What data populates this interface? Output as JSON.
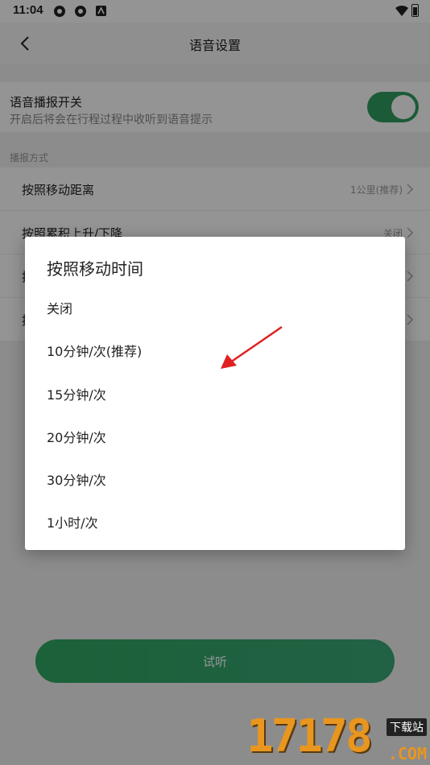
{
  "status": {
    "time": "11:04"
  },
  "appbar": {
    "title": "语音设置"
  },
  "voice_switch": {
    "label": "语音播报开关",
    "description": "开启后将会在行程过程中收听到语音提示",
    "enabled": true
  },
  "section": {
    "label": "播报方式"
  },
  "rows": [
    {
      "label": "按照移动距离",
      "value": "1公里(推荐)"
    },
    {
      "label": "按照累积上升/下降",
      "value": "关闭"
    },
    {
      "label": "按",
      "value": ""
    },
    {
      "label": "按",
      "value": ""
    }
  ],
  "try_button": {
    "label": "试听"
  },
  "dialog": {
    "title": "按照移动时间",
    "options": [
      "关闭",
      "10分钟/次(推荐)",
      "15分钟/次",
      "20分钟/次",
      "30分钟/次",
      "1小时/次"
    ]
  },
  "watermark": {
    "number": "17178",
    "tag": "下载站",
    "domain": ".COM"
  },
  "colors": {
    "accent": "#2f9e5f",
    "arrow": "#e02020",
    "watermark": "#e8961f"
  }
}
